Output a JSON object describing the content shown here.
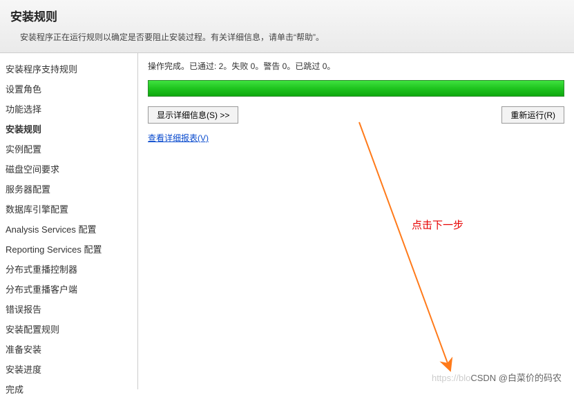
{
  "header": {
    "title": "安装规则",
    "subtitle": "安装程序正在运行规则以确定是否要阻止安装过程。有关详细信息，请单击“帮助”。"
  },
  "sidebar": {
    "items": [
      {
        "label": "安装程序支持规则",
        "active": false
      },
      {
        "label": "设置角色",
        "active": false
      },
      {
        "label": "功能选择",
        "active": false
      },
      {
        "label": "安装规则",
        "active": true
      },
      {
        "label": "实例配置",
        "active": false
      },
      {
        "label": "磁盘空间要求",
        "active": false
      },
      {
        "label": "服务器配置",
        "active": false
      },
      {
        "label": "数据库引擎配置",
        "active": false
      },
      {
        "label": "Analysis Services 配置",
        "active": false
      },
      {
        "label": "Reporting Services 配置",
        "active": false
      },
      {
        "label": "分布式重播控制器",
        "active": false
      },
      {
        "label": "分布式重播客户端",
        "active": false
      },
      {
        "label": "错误报告",
        "active": false
      },
      {
        "label": "安装配置规则",
        "active": false
      },
      {
        "label": "准备安装",
        "active": false
      },
      {
        "label": "安装进度",
        "active": false
      },
      {
        "label": "完成",
        "active": false
      }
    ]
  },
  "main": {
    "status_text": "操作完成。已通过: 2。失败 0。警告 0。已跳过 0。",
    "show_details_label": "显示详细信息(S) >>",
    "rerun_label": "重新运行(R)",
    "view_report_label": "查看详细报表(V)"
  },
  "annotation": {
    "text": "点击下一步"
  },
  "watermark": {
    "faint": "https://blo",
    "text": "CSDN @白菜价的码农"
  }
}
